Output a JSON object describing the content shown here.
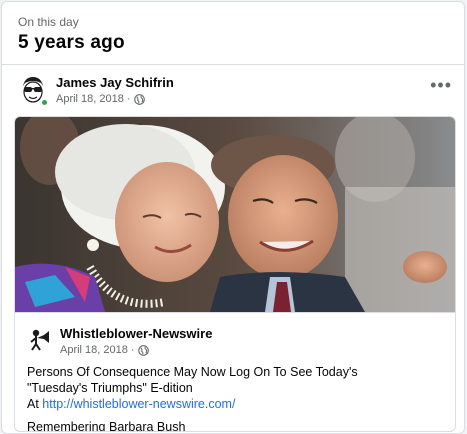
{
  "memory": {
    "label": "On this day",
    "title": "5 years ago"
  },
  "post": {
    "author": "James Jay Schifrin",
    "date": "April 18, 2018",
    "dot": "·",
    "privacy_icon": "globe-icon",
    "more_icon": "more-dots-icon",
    "more_label": "•••",
    "avatar_icon": "profile-cartoon-avatar",
    "online_color": "#31a24c"
  },
  "shared": {
    "photo_description_icon": "photo",
    "page_name": "Whistleblower-Newswire",
    "date": "April 18, 2018",
    "dot": "·",
    "privacy_icon": "globe-icon",
    "text_line1": "Persons Of Consequence May Now Log On To See Today's",
    "text_line2": "\"Tuesday's Triumphs\" E-dition",
    "text_at": "At",
    "link": "http://whistleblower-newswire.com/",
    "caption": "Remembering Barbara Bush"
  },
  "colors": {
    "link": "#216fdb",
    "secondary_text": "#65676b",
    "divider": "#dadde1"
  }
}
